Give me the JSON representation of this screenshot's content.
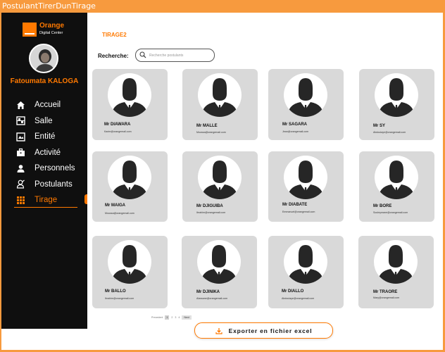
{
  "window": {
    "title": "PostulantTirerDunTirage"
  },
  "brand": {
    "name": "Orange",
    "subtitle": "Digital Center"
  },
  "user": {
    "name": "Fatoumata KALOGA"
  },
  "nav": [
    {
      "label": "Accueil",
      "icon": "home-icon"
    },
    {
      "label": "Salle",
      "icon": "room-icon"
    },
    {
      "label": "Entité",
      "icon": "entity-icon"
    },
    {
      "label": "Activité",
      "icon": "briefcase-icon"
    },
    {
      "label": "Personnels",
      "icon": "person-icon"
    },
    {
      "label": "Postulants",
      "icon": "applicants-icon"
    },
    {
      "label": "Tirage",
      "icon": "grid-icon",
      "active": true
    }
  ],
  "page": {
    "title": "TIRAGE2"
  },
  "search": {
    "label": "Recherche:",
    "placeholder": "Recherche postulants"
  },
  "candidates": [
    {
      "name": "Mr DIAWARA",
      "email": "Karim@orangemail.com"
    },
    {
      "name": "Mr MALLE",
      "email": "Moussa@orangemail.com"
    },
    {
      "name": "Mr SAGARA",
      "email": "Jean@orangemail.com"
    },
    {
      "name": "Mr SY",
      "email": "Abdoulaye@orangemail.com"
    },
    {
      "name": "Mr MAIGA",
      "email": "Moussa@orangemail.com"
    },
    {
      "name": "Mr DJIGUIBA",
      "email": "Ibrahim@orangemail.com"
    },
    {
      "name": "Mr DIABATE",
      "email": "Emmanuel@orangemail.com"
    },
    {
      "name": "Mr BORE",
      "email": "Souleymane@orangemail.com"
    },
    {
      "name": "Mr BALLO",
      "email": "Ibrahim@orangemail.com"
    },
    {
      "name": "Mr DJINIKA",
      "email": "Alassane@orangemail.com"
    },
    {
      "name": "Mr DIALLO",
      "email": "Abdoulaye@orangemail.com"
    },
    {
      "name": "Mr TRAORE",
      "email": "Mary@orangemail.com"
    }
  ],
  "pagination": {
    "prev": "Precedent",
    "pages": [
      "1",
      "2",
      "3",
      "4"
    ],
    "current": "1",
    "next": "Next"
  },
  "export": {
    "label": "Exporter en fichier excel",
    "icon": "download-icon"
  },
  "colors": {
    "accent": "#ff7900",
    "sidebar": "#0f0f0f",
    "card": "#d9d9d9",
    "frame": "#f79a3e"
  }
}
